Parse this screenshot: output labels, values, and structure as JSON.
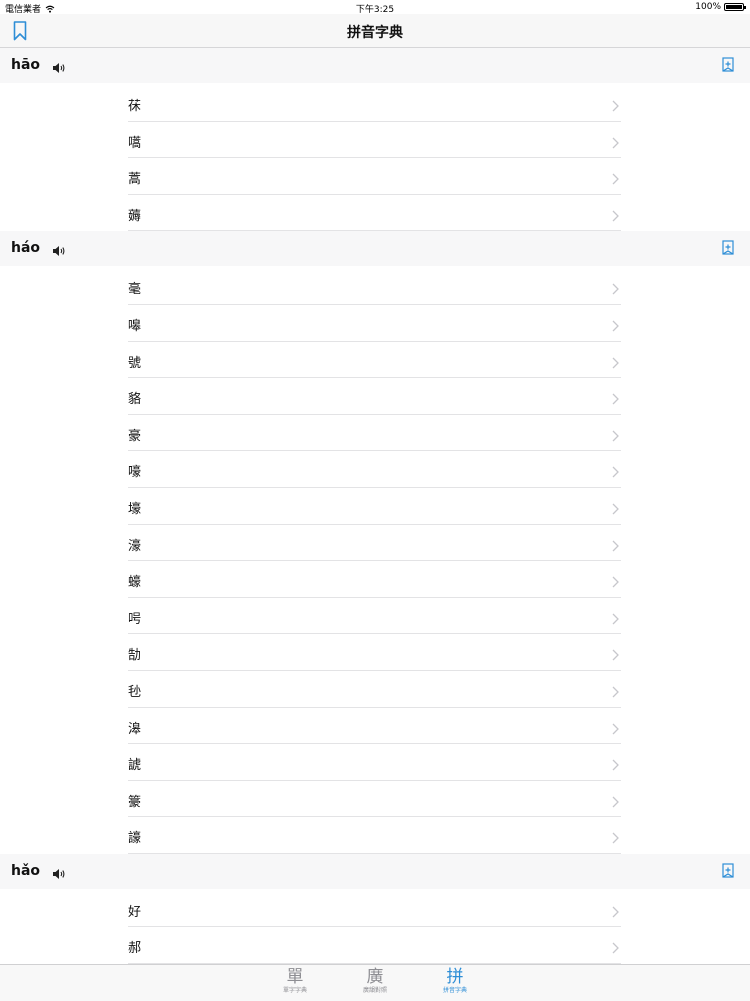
{
  "status": {
    "carrier": "電信業者",
    "time": "下午3:25",
    "battery": "100%"
  },
  "nav": {
    "title": "拼音字典",
    "bookmark_icon": "bookmark-icon"
  },
  "sections": [
    {
      "pinyin": "hāo",
      "chars": [
        "茠",
        "嚆",
        "蒿",
        "薅"
      ]
    },
    {
      "pinyin": "háo",
      "chars": [
        "毫",
        "嗥",
        "號",
        "貉",
        "豪",
        "嚎",
        "壕",
        "濠",
        "蠔",
        "呺",
        "勂",
        "毜",
        "滜",
        "諕",
        "籇",
        "譹"
      ]
    },
    {
      "pinyin": "hǎo",
      "chars": [
        "好",
        "郝"
      ]
    }
  ],
  "tabs": [
    {
      "glyph": "單",
      "label": "單字字典",
      "active": false
    },
    {
      "glyph": "廣",
      "label": "廣韻對照",
      "active": false
    },
    {
      "glyph": "拼",
      "label": "拼音字典",
      "active": true
    }
  ],
  "colors": {
    "accent": "#2e8ed6"
  }
}
